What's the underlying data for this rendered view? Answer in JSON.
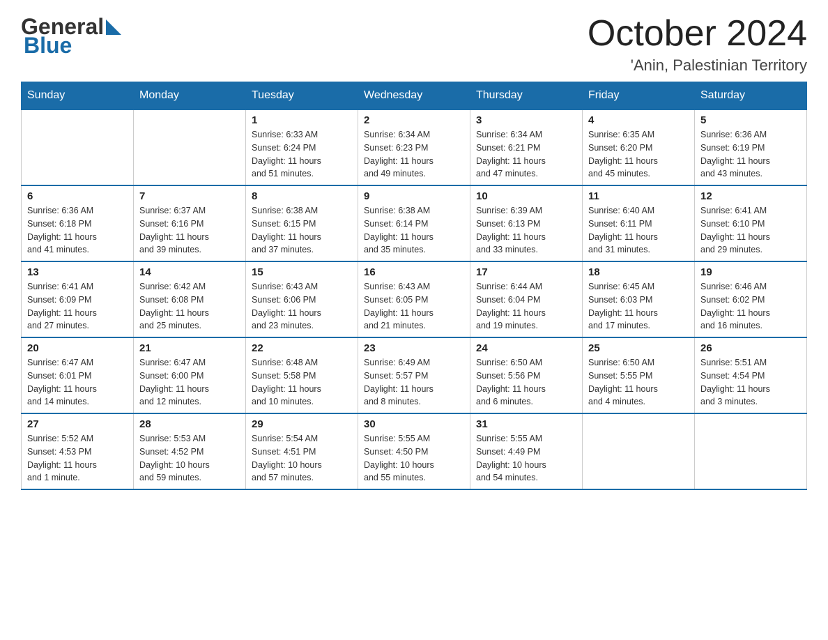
{
  "header": {
    "logo": {
      "general": "General",
      "blue": "Blue"
    },
    "title": "October 2024",
    "location": "'Anin, Palestinian Territory"
  },
  "days_of_week": [
    "Sunday",
    "Monday",
    "Tuesday",
    "Wednesday",
    "Thursday",
    "Friday",
    "Saturday"
  ],
  "weeks": [
    [
      {
        "date": "",
        "info": ""
      },
      {
        "date": "",
        "info": ""
      },
      {
        "date": "1",
        "info": "Sunrise: 6:33 AM\nSunset: 6:24 PM\nDaylight: 11 hours\nand 51 minutes."
      },
      {
        "date": "2",
        "info": "Sunrise: 6:34 AM\nSunset: 6:23 PM\nDaylight: 11 hours\nand 49 minutes."
      },
      {
        "date": "3",
        "info": "Sunrise: 6:34 AM\nSunset: 6:21 PM\nDaylight: 11 hours\nand 47 minutes."
      },
      {
        "date": "4",
        "info": "Sunrise: 6:35 AM\nSunset: 6:20 PM\nDaylight: 11 hours\nand 45 minutes."
      },
      {
        "date": "5",
        "info": "Sunrise: 6:36 AM\nSunset: 6:19 PM\nDaylight: 11 hours\nand 43 minutes."
      }
    ],
    [
      {
        "date": "6",
        "info": "Sunrise: 6:36 AM\nSunset: 6:18 PM\nDaylight: 11 hours\nand 41 minutes."
      },
      {
        "date": "7",
        "info": "Sunrise: 6:37 AM\nSunset: 6:16 PM\nDaylight: 11 hours\nand 39 minutes."
      },
      {
        "date": "8",
        "info": "Sunrise: 6:38 AM\nSunset: 6:15 PM\nDaylight: 11 hours\nand 37 minutes."
      },
      {
        "date": "9",
        "info": "Sunrise: 6:38 AM\nSunset: 6:14 PM\nDaylight: 11 hours\nand 35 minutes."
      },
      {
        "date": "10",
        "info": "Sunrise: 6:39 AM\nSunset: 6:13 PM\nDaylight: 11 hours\nand 33 minutes."
      },
      {
        "date": "11",
        "info": "Sunrise: 6:40 AM\nSunset: 6:11 PM\nDaylight: 11 hours\nand 31 minutes."
      },
      {
        "date": "12",
        "info": "Sunrise: 6:41 AM\nSunset: 6:10 PM\nDaylight: 11 hours\nand 29 minutes."
      }
    ],
    [
      {
        "date": "13",
        "info": "Sunrise: 6:41 AM\nSunset: 6:09 PM\nDaylight: 11 hours\nand 27 minutes."
      },
      {
        "date": "14",
        "info": "Sunrise: 6:42 AM\nSunset: 6:08 PM\nDaylight: 11 hours\nand 25 minutes."
      },
      {
        "date": "15",
        "info": "Sunrise: 6:43 AM\nSunset: 6:06 PM\nDaylight: 11 hours\nand 23 minutes."
      },
      {
        "date": "16",
        "info": "Sunrise: 6:43 AM\nSunset: 6:05 PM\nDaylight: 11 hours\nand 21 minutes."
      },
      {
        "date": "17",
        "info": "Sunrise: 6:44 AM\nSunset: 6:04 PM\nDaylight: 11 hours\nand 19 minutes."
      },
      {
        "date": "18",
        "info": "Sunrise: 6:45 AM\nSunset: 6:03 PM\nDaylight: 11 hours\nand 17 minutes."
      },
      {
        "date": "19",
        "info": "Sunrise: 6:46 AM\nSunset: 6:02 PM\nDaylight: 11 hours\nand 16 minutes."
      }
    ],
    [
      {
        "date": "20",
        "info": "Sunrise: 6:47 AM\nSunset: 6:01 PM\nDaylight: 11 hours\nand 14 minutes."
      },
      {
        "date": "21",
        "info": "Sunrise: 6:47 AM\nSunset: 6:00 PM\nDaylight: 11 hours\nand 12 minutes."
      },
      {
        "date": "22",
        "info": "Sunrise: 6:48 AM\nSunset: 5:58 PM\nDaylight: 11 hours\nand 10 minutes."
      },
      {
        "date": "23",
        "info": "Sunrise: 6:49 AM\nSunset: 5:57 PM\nDaylight: 11 hours\nand 8 minutes."
      },
      {
        "date": "24",
        "info": "Sunrise: 6:50 AM\nSunset: 5:56 PM\nDaylight: 11 hours\nand 6 minutes."
      },
      {
        "date": "25",
        "info": "Sunrise: 6:50 AM\nSunset: 5:55 PM\nDaylight: 11 hours\nand 4 minutes."
      },
      {
        "date": "26",
        "info": "Sunrise: 5:51 AM\nSunset: 4:54 PM\nDaylight: 11 hours\nand 3 minutes."
      }
    ],
    [
      {
        "date": "27",
        "info": "Sunrise: 5:52 AM\nSunset: 4:53 PM\nDaylight: 11 hours\nand 1 minute."
      },
      {
        "date": "28",
        "info": "Sunrise: 5:53 AM\nSunset: 4:52 PM\nDaylight: 10 hours\nand 59 minutes."
      },
      {
        "date": "29",
        "info": "Sunrise: 5:54 AM\nSunset: 4:51 PM\nDaylight: 10 hours\nand 57 minutes."
      },
      {
        "date": "30",
        "info": "Sunrise: 5:55 AM\nSunset: 4:50 PM\nDaylight: 10 hours\nand 55 minutes."
      },
      {
        "date": "31",
        "info": "Sunrise: 5:55 AM\nSunset: 4:49 PM\nDaylight: 10 hours\nand 54 minutes."
      },
      {
        "date": "",
        "info": ""
      },
      {
        "date": "",
        "info": ""
      }
    ]
  ]
}
